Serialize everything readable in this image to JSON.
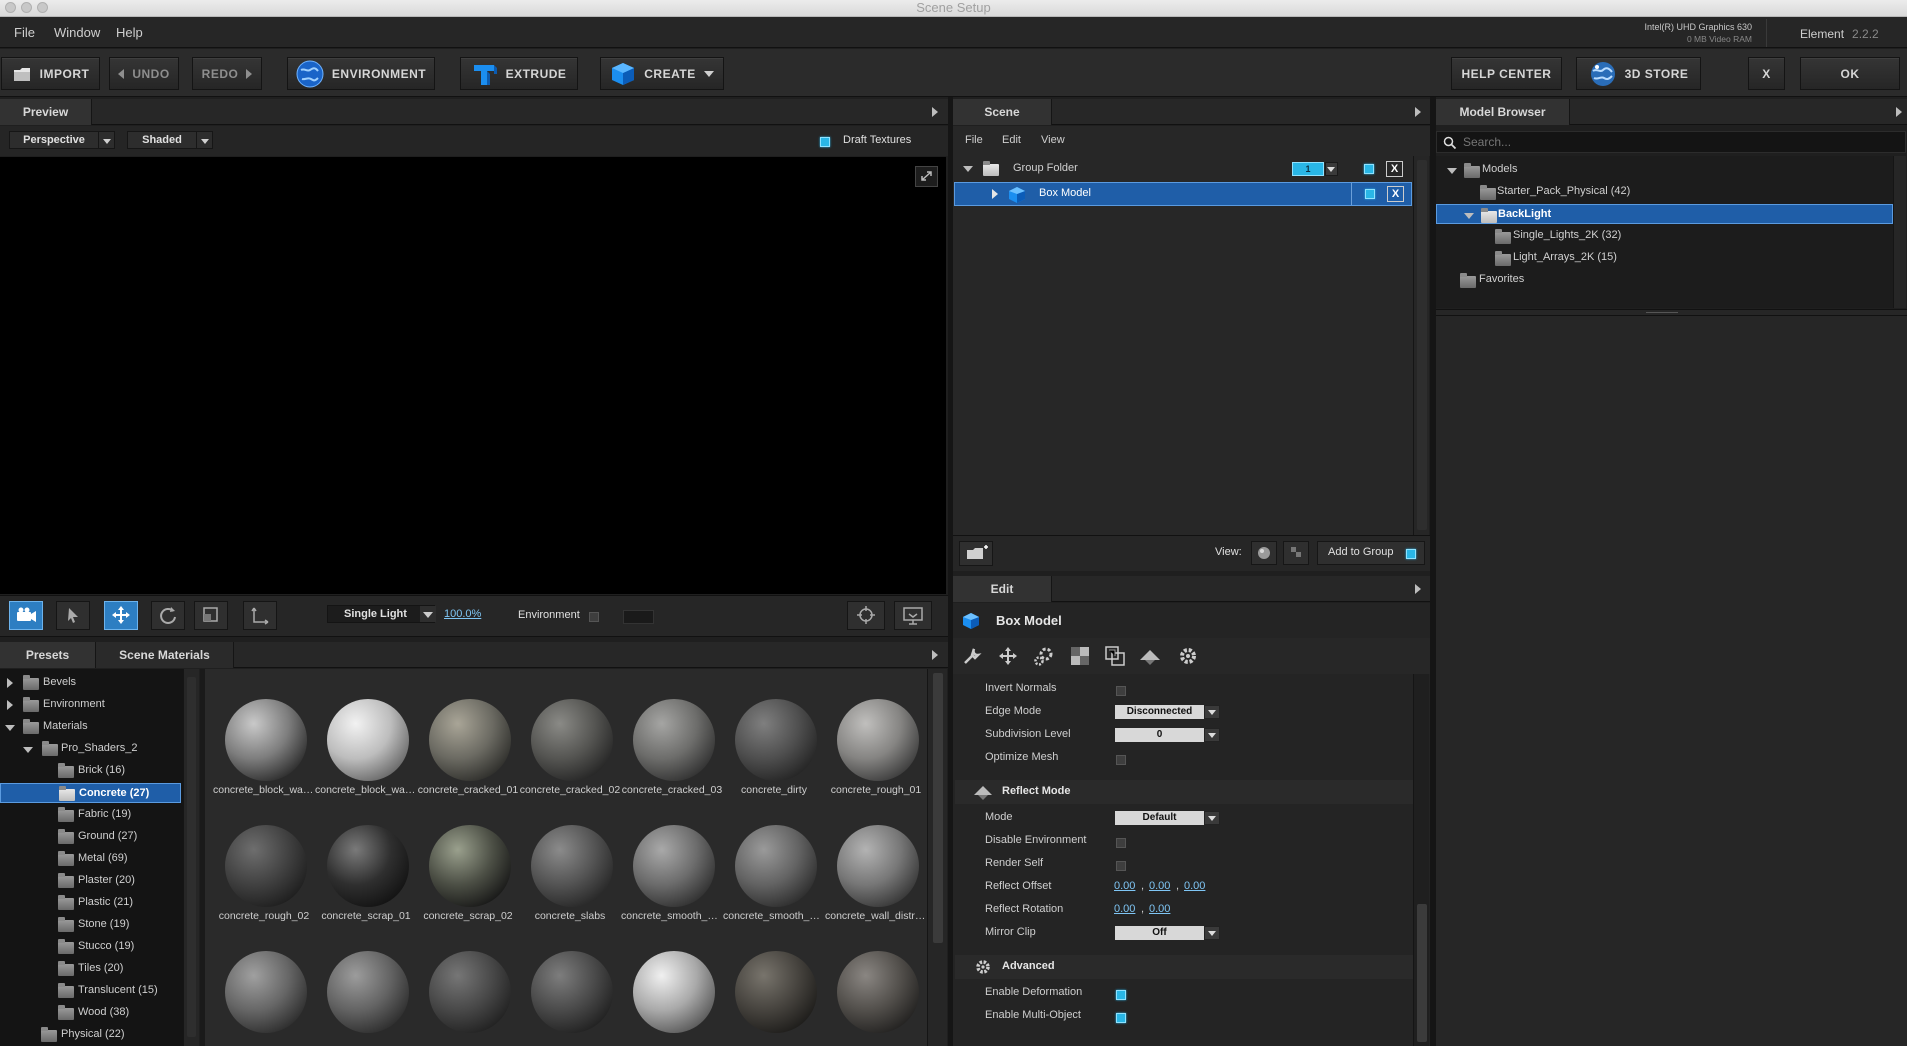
{
  "window": {
    "title": "Scene Setup"
  },
  "menu": [
    "File",
    "Window",
    "Help"
  ],
  "gpu": {
    "name": "Intel(R) UHD Graphics 630",
    "vram": "0 MB Video RAM"
  },
  "app": {
    "name": "Element",
    "version": "2.2.2"
  },
  "toolbar": {
    "import": "IMPORT",
    "undo": "UNDO",
    "redo": "REDO",
    "environment": "ENVIRONMENT",
    "extrude": "EXTRUDE",
    "create": "CREATE",
    "help_center": "HELP CENTER",
    "store": "3D STORE",
    "close": "X",
    "ok": "OK"
  },
  "preview": {
    "tab": "Preview",
    "view_mode": "Perspective",
    "shading": "Shaded",
    "draft_textures_label": "Draft Textures",
    "draft_textures": true,
    "light_mode": "Single Light",
    "zoom": "100.0%",
    "environment_label": "Environment",
    "environment": false
  },
  "scene": {
    "tab": "Scene",
    "menu": [
      "File",
      "Edit",
      "View"
    ],
    "items": [
      {
        "name": "Group Folder",
        "counter": "1"
      },
      {
        "name": "Box Model"
      }
    ],
    "view_label": "View:",
    "add_to_group": "Add to Group"
  },
  "edit": {
    "tab": "Edit",
    "object": "Box Model",
    "props": {
      "invert_normals": "Invert Normals",
      "edge_mode": "Edge Mode",
      "edge_mode_value": "Disconnected",
      "subdivision_level": "Subdivision Level",
      "subdivision_value": "0",
      "optimize_mesh": "Optimize Mesh"
    },
    "reflect": {
      "header": "Reflect Mode",
      "mode": "Mode",
      "mode_value": "Default",
      "disable_environment": "Disable Environment",
      "render_self": "Render Self",
      "reflect_offset": "Reflect Offset",
      "offset": [
        "0.00",
        "0.00",
        "0.00"
      ],
      "reflect_rotation": "Reflect Rotation",
      "rotation": [
        "0.00",
        "0.00"
      ],
      "mirror_clip": "Mirror Clip",
      "mirror_clip_value": "Off"
    },
    "advanced": {
      "header": "Advanced",
      "enable_deformation": "Enable Deformation",
      "enable_multi_object": "Enable Multi-Object"
    }
  },
  "model_browser": {
    "tab": "Model Browser",
    "search_placeholder": "Search...",
    "tree": [
      "Models",
      "Starter_Pack_Physical (42)",
      "BackLight",
      "Single_Lights_2K (32)",
      "Light_Arrays_2K (15)",
      "Favorites"
    ]
  },
  "presets": {
    "tabs": [
      "Presets",
      "Scene Materials"
    ],
    "tree": [
      "Bevels",
      "Environment",
      "Materials",
      "Pro_Shaders_2",
      "Brick (16)",
      "Concrete (27)",
      "Fabric (19)",
      "Ground (27)",
      "Metal (69)",
      "Plaster (20)",
      "Plastic (21)",
      "Stone (19)",
      "Stucco (19)",
      "Tiles (20)",
      "Translucent (15)",
      "Wood (38)",
      "Physical (22)"
    ],
    "materials": [
      "concrete_block_wall...",
      "concrete_block_wall...",
      "concrete_cracked_01",
      "concrete_cracked_02",
      "concrete_cracked_03",
      "concrete_dirty",
      "concrete_rough_01",
      "concrete_rough_02",
      "concrete_scrap_01",
      "concrete_scrap_02",
      "concrete_slabs",
      "concrete_smooth_cr...",
      "concrete_smooth_gr...",
      "concrete_wall_distre..."
    ]
  },
  "colors": {
    "accent": "#29b6e6",
    "selection": "#1f5ea8"
  }
}
